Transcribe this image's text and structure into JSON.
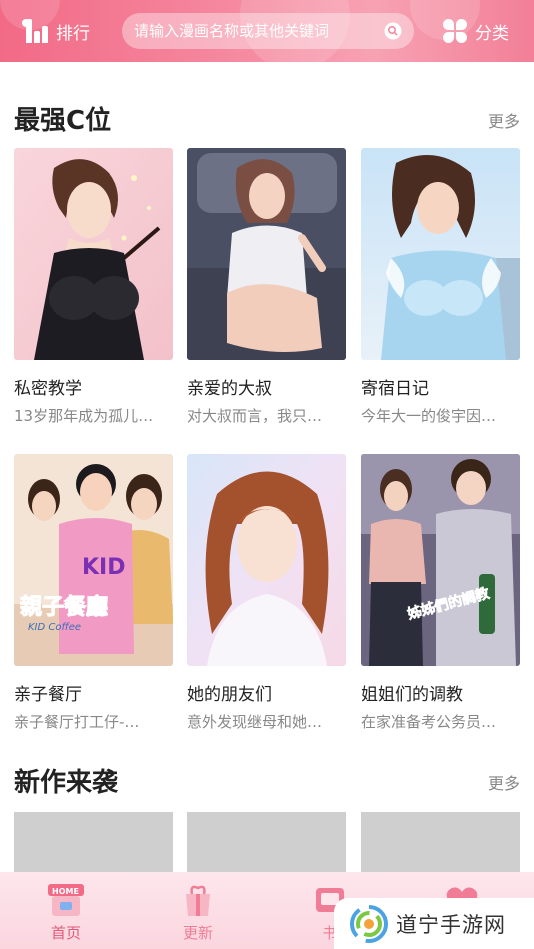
{
  "header": {
    "rank_label": "排行",
    "search_placeholder": "请输入漫画名称或其他关键词",
    "category_label": "分类"
  },
  "sections": {
    "top": {
      "title": "最强C位",
      "more": "更多"
    },
    "new": {
      "title": "新作来袭",
      "more": "更多"
    }
  },
  "top_comics": [
    {
      "title": "私密教学",
      "desc": "13岁那年成为孤儿…"
    },
    {
      "title": "亲爱的大叔",
      "desc": "对大叔而言，我只…"
    },
    {
      "title": "寄宿日记",
      "desc": "今年大一的俊宇因…"
    },
    {
      "title": "亲子餐厅",
      "desc": "亲子餐厅打工仔-…"
    },
    {
      "title": "她的朋友们",
      "desc": "意外发现继母和她…"
    },
    {
      "title": "姐姐们的调教",
      "desc": "在家准备考公务员…"
    }
  ],
  "cover_text": {
    "kid_logo": "親子餐廳",
    "kid_sub": "KID Coffee",
    "kid_shirt": "KID",
    "sister_logo": "姊姊們的調教"
  },
  "bottom_nav": [
    {
      "label": "首页",
      "badge": "HOME"
    },
    {
      "label": "更新"
    },
    {
      "label": "书"
    }
  ],
  "watermark": {
    "text": "道宁手游网"
  },
  "colors": {
    "accent": "#f26a86",
    "text": "#222222",
    "muted": "#888888"
  }
}
